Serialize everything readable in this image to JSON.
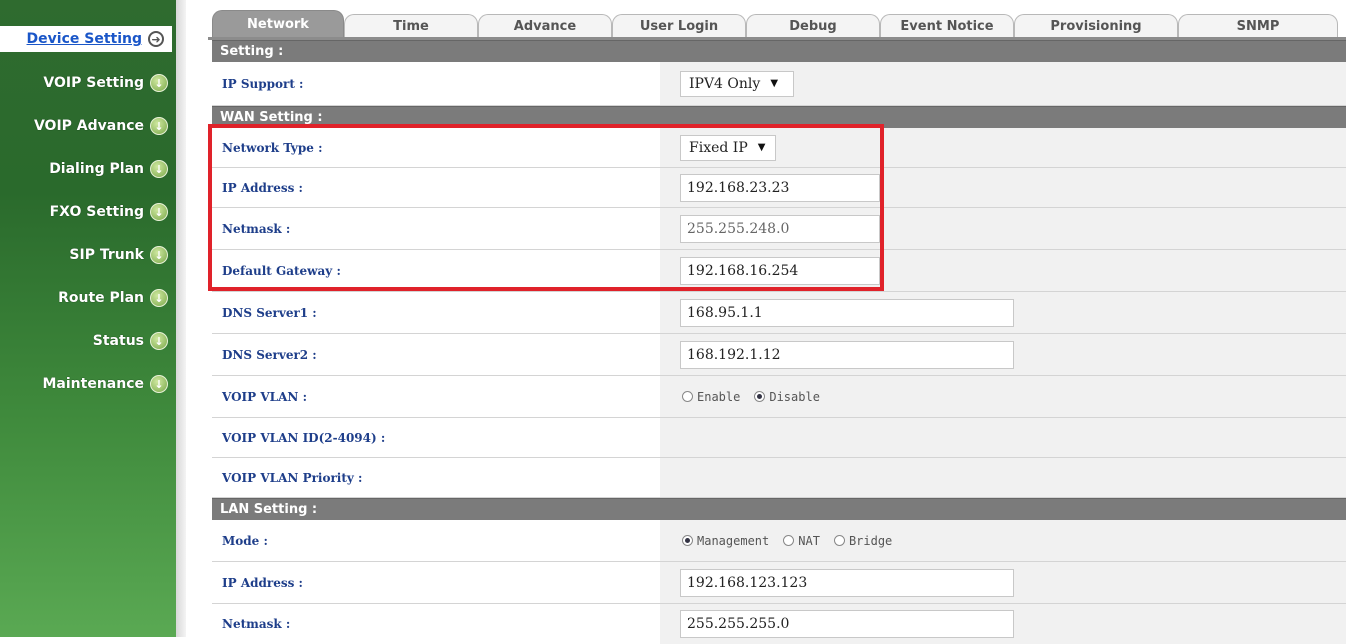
{
  "sidebar": {
    "items": [
      {
        "label": "Device Setting",
        "active": true,
        "icon": "right-arrow-circle-icon"
      },
      {
        "label": "VOIP Setting",
        "icon": "down-arrow-circle-icon"
      },
      {
        "label": "VOIP Advance",
        "icon": "down-arrow-circle-icon"
      },
      {
        "label": "Dialing Plan",
        "icon": "down-arrow-circle-icon"
      },
      {
        "label": "FXO Setting",
        "icon": "down-arrow-circle-icon"
      },
      {
        "label": "SIP Trunk",
        "icon": "down-arrow-circle-icon"
      },
      {
        "label": "Route Plan",
        "icon": "down-arrow-circle-icon"
      },
      {
        "label": "Status",
        "icon": "down-arrow-circle-icon"
      },
      {
        "label": "Maintenance",
        "icon": "down-arrow-circle-icon"
      }
    ]
  },
  "tabs": [
    "Network",
    "Time",
    "Advance",
    "User Login",
    "Debug",
    "Event Notice",
    "Provisioning",
    "SNMP"
  ],
  "active_tab": "Network",
  "sections": {
    "setting": "Setting :",
    "wan": "WAN Setting :",
    "lan": "LAN Setting :"
  },
  "setting": {
    "ip_support_label": "IP Support :",
    "ip_support_value": "IPV4 Only"
  },
  "wan": {
    "network_type_label": "Network Type :",
    "network_type_value": "Fixed IP",
    "ip_address_label": "IP Address :",
    "ip_address_value": "192.168.23.23",
    "netmask_label": "Netmask :",
    "netmask_value": "255.255.248.0",
    "gateway_label": "Default Gateway :",
    "gateway_value": "192.168.16.254",
    "dns1_label": "DNS Server1 :",
    "dns1_value": "168.95.1.1",
    "dns2_label": "DNS Server2 :",
    "dns2_value": "168.192.1.12",
    "vlan_label": "VOIP VLAN :",
    "vlan_enable": "Enable",
    "vlan_disable": "Disable",
    "vlan_selected": "Disable",
    "vlan_id_label": "VOIP VLAN ID(2-4094) :",
    "vlan_priority_label": "VOIP VLAN Priority :"
  },
  "lan": {
    "mode_label": "Mode :",
    "mode_options": [
      "Management",
      "NAT",
      "Bridge"
    ],
    "mode_selected": "Management",
    "ip_address_label": "IP Address :",
    "ip_address_value": "192.168.123.123",
    "netmask_label": "Netmask :",
    "netmask_value": "255.255.255.0"
  },
  "colors": {
    "sidebar_green": "#2f6b2f",
    "active_link": "#1a56c8",
    "label_blue": "#1e3e8a",
    "highlight_red": "#e0222a",
    "section_gray": "#7b7b7b"
  }
}
